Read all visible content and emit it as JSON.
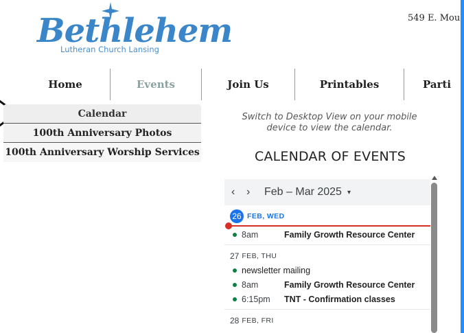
{
  "logo": {
    "wordmark": "Bethlehem",
    "subtitle": "Lutheran Church Lansing"
  },
  "header": {
    "address": "549 E. Mou"
  },
  "nav": {
    "items": [
      {
        "label": "Home"
      },
      {
        "label": "Events"
      },
      {
        "label": "Join Us"
      },
      {
        "label": "Printables"
      },
      {
        "label": "Parti"
      }
    ]
  },
  "dropdown": {
    "items": [
      {
        "label": "Calendar"
      },
      {
        "label": "100th Anniversary Photos"
      },
      {
        "label": "100th Anniversary Worship Services"
      }
    ]
  },
  "calendar_section": {
    "switch_note": "Switch to Desktop View on your mobile device to view the calendar.",
    "heading": "CALENDAR OF EVENTS"
  },
  "calendar": {
    "range": "Feb – Mar 2025",
    "prev_icon": "‹",
    "next_icon": "›",
    "caret_icon": "▾",
    "days": [
      {
        "num": "26",
        "dow": "FEB, WED",
        "events": [
          {
            "time": "8am",
            "title": "Family Growth Resource Center"
          }
        ]
      },
      {
        "num": "27",
        "dow": "FEB, THU",
        "events": [
          {
            "time": "",
            "title": "newsletter mailing"
          },
          {
            "time": "8am",
            "title": "Family Growth Resource Center"
          },
          {
            "time": "6:15pm",
            "title": "TNT - Confirmation classes"
          }
        ]
      },
      {
        "num": "28",
        "dow": "FEB, FRI",
        "events": []
      }
    ]
  },
  "colors": {
    "accent": "#1e90ff",
    "logo_blue": "#3a86c8",
    "today_blue": "#1a73e8",
    "now_red": "#d93025",
    "event_green": "#0b8043",
    "nav_active": "#8aa3a0"
  }
}
